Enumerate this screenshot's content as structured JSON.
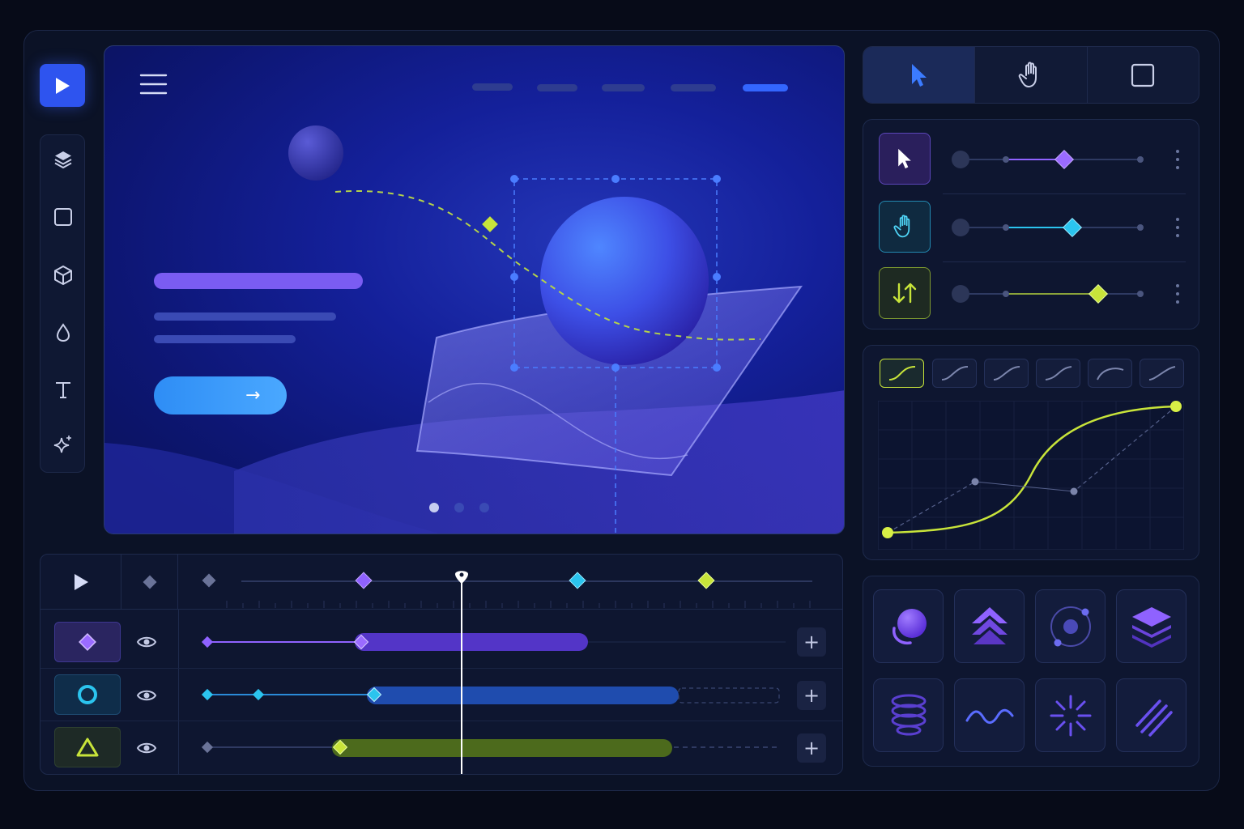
{
  "colors": {
    "accent_blue": "#2e54ef",
    "purple": "#8f62ff",
    "cyan": "#2bc4ee",
    "lime": "#c8e43a",
    "background": "#070b18"
  },
  "left_rail": {
    "play_icon": "play-icon",
    "tools": [
      "layers-icon",
      "rectangle-icon",
      "cube-icon",
      "drop-icon",
      "text-icon",
      "sparkle-icon"
    ],
    "text_tool_glyph": "T"
  },
  "canvas": {
    "nav_items": 5,
    "active_nav": 5,
    "carousel_active": 1,
    "carousel_total": 3,
    "cta_arrow": "→"
  },
  "tool_tabs": [
    {
      "icon": "pointer-icon",
      "active": true
    },
    {
      "icon": "hand-icon",
      "active": false
    },
    {
      "icon": "frame-icon",
      "active": false
    }
  ],
  "properties": [
    {
      "icon": "pointer-icon",
      "color": "#8f62ff",
      "value": 0.58
    },
    {
      "icon": "hand-icon",
      "color": "#2bc4ee",
      "value": 0.62
    },
    {
      "icon": "swap-vertical-icon",
      "color": "#c8e43a",
      "value": 0.76
    }
  ],
  "easing": {
    "presets": 6,
    "active": 0,
    "curve_icon": "ease-curve-icon"
  },
  "presets": [
    "orbit-sphere-icon",
    "stacked-chevrons-icon",
    "orbit-ring-icon",
    "layer-stack-icon",
    "spring-coil-icon",
    "wave-icon",
    "burst-icon",
    "diagonal-lines-icon"
  ],
  "timeline": {
    "play_icon": "play-icon",
    "playhead": 0.43,
    "plus_label": "+",
    "tracks": [
      {
        "chip_icon": "diamond-icon",
        "color": "#8f62ff",
        "visible": true
      },
      {
        "chip_icon": "circle-icon",
        "color": "#2bc4ee",
        "visible": true
      },
      {
        "chip_icon": "triangle-icon",
        "color": "#c8e43a",
        "visible": true
      }
    ]
  }
}
